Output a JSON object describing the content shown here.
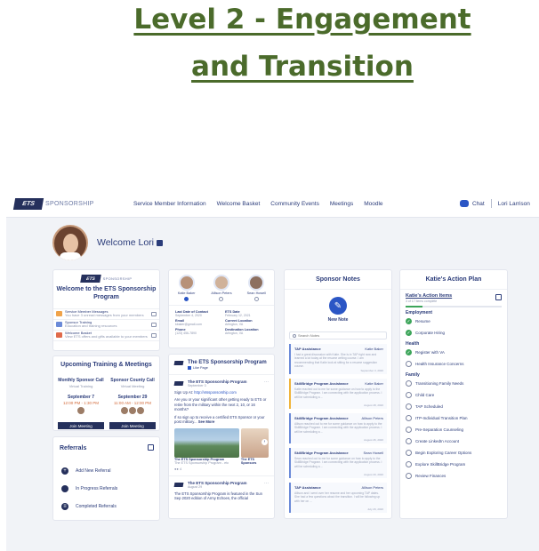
{
  "slide": {
    "title_line1": "Level 2 - Engagement",
    "title_line2": "and Transition"
  },
  "nav": {
    "logo": "ETS",
    "logo_word": "SPONSORSHIP",
    "links": [
      "Service Member Information",
      "Welcome Basket",
      "Community Events",
      "Meetings",
      "Moodle"
    ],
    "chat": "Chat",
    "user": "Lori Larrison"
  },
  "welcome": {
    "text": "Welcome Lori"
  },
  "program_card": {
    "title_line1": "Welcome to the ETS Sponsorship",
    "title_line2": "Program",
    "rows": [
      {
        "title": "Service Member Messages",
        "sub": "You have 3 unread messages from your members"
      },
      {
        "title": "Sponsor Training",
        "sub": "Education and training resources"
      },
      {
        "title": "Welcome Basket",
        "sub": "View ETS offers and gifts available to your members"
      }
    ]
  },
  "training": {
    "title": "Upcoming Training & Meetings",
    "meetings": [
      {
        "title": "Monthly Sponsor Call",
        "sub": "Virtual Training",
        "date": "September 7",
        "time": "12:00 PM - 1:30 PM",
        "join": "Join Meeting"
      },
      {
        "title": "Sponsor County Call",
        "sub": "Virtual Meeting",
        "date": "September 29",
        "time": "11:00 AM - 12:00 PM",
        "join": "Join Meeting"
      }
    ]
  },
  "referrals": {
    "title": "Referrals",
    "items": [
      "Add New Referral",
      "In Progress Referrals",
      "Completed Referrals"
    ]
  },
  "member_card": {
    "people": [
      {
        "name": "Katie Baker",
        "selected": true
      },
      {
        "name": "Allison Peters",
        "selected": false
      },
      {
        "name": "Sean Howell",
        "selected": false
      }
    ],
    "fields": [
      {
        "k": "Last Date of Contact",
        "v": "September 4, 2020"
      },
      {
        "k": "ETS Date",
        "v": "February 12, 2021"
      },
      {
        "k": "Email",
        "v": "kbaker@gmail.com"
      },
      {
        "k": "Current Location",
        "v": "Arlington, VA"
      },
      {
        "k": "Phone",
        "v": "(123) 456-7890"
      },
      {
        "k": "Destination Location",
        "v": "Arlington, VA"
      }
    ]
  },
  "feed": {
    "title": "The ETS Sponsorship Program",
    "sub": "Like Page",
    "post1": {
      "author": "The ETS Sponsorship Program",
      "date": "September 3",
      "signup": "Sign Up At:",
      "link": "http://etssponsorship.com",
      "body": "Are you or your significant other getting ready to ETS or retire from the military within the next 2, 10, or 16 months?",
      "body2": "If so sign up to receive a certified ETS Sponsor or your post military...",
      "see_more": "See More",
      "caption1_title": "The ETS Sponsorship Program",
      "caption1_sub": "The ETS Sponsorship Program - etc",
      "caption2_title": "The ETS Sponsors",
      "reactions": "4"
    },
    "post2": {
      "author": "The ETS Sponsorship Program",
      "date": "August 29",
      "body": "The ETS Sponsorship Program is featured in the Sun Sep 2020 edition of Army Echoes, the official"
    }
  },
  "sponsor_notes": {
    "title": "Sponsor Notes",
    "new_note": "New Note",
    "search_placeholder": "Search Notes",
    "notes": [
      {
        "title": "TAP Assistance",
        "who": "Katie Baker",
        "body": "I had a great discussion with Katie. She is in TAP right now and learned a lot today at the resume writing course. I am recommending that Katie look at sitting for a resume suggestion course.",
        "date": "September 3, 2020",
        "color": "blue"
      },
      {
        "title": "SkillBridge Program Assistance",
        "who": "Katie Baker",
        "body": "Katie reached out to me for some guidance on how to apply to the SkillBridge Program. I am connecting with the application process. I will be scheduling a ...",
        "date": "August 28, 2020",
        "color": "yellow"
      },
      {
        "title": "SkillBridge Program Assistance",
        "who": "Allison Peters",
        "body": "Allison reached out to me for some guidance on how to apply to the SkillBridge Program. I am connecting with the application process. I will be scheduling a ...",
        "date": "August 26, 2020",
        "color": "blue"
      },
      {
        "title": "SkillBridge Program Assistance",
        "who": "Sean Howell",
        "body": "Sean reached out to me for some guidance on how to apply to the SkillBridge Program. I am connecting with the application process. I will be scheduling a ...",
        "date": "August 20, 2020",
        "color": "blue"
      },
      {
        "title": "TAP Assistance",
        "who": "Allison Peters",
        "body": "Allison and I went over her resume and her upcoming TAP dates. She had a few questions about the transition. I will be following up with her on ...",
        "date": "July 29, 2020",
        "color": "blue"
      }
    ]
  },
  "action_plan": {
    "title": "Katie's Action Plan",
    "items_title": "Katie's Action Items",
    "items_sub": "3 of 17 items complete",
    "progress": 0.18,
    "categories": [
      {
        "name": "Employment",
        "tasks": [
          {
            "label": "Resume",
            "done": true
          },
          {
            "label": "Corporate Hiring",
            "done": true
          }
        ]
      },
      {
        "name": "Health",
        "tasks": [
          {
            "label": "Register with VA",
            "done": true
          },
          {
            "label": "Health Insurance Concerns",
            "done": false
          }
        ]
      },
      {
        "name": "Family",
        "tasks": [
          {
            "label": "Transitioning Family Needs",
            "done": false
          },
          {
            "label": "Child Care",
            "done": false
          },
          {
            "label": "TAP Scheduled",
            "done": false
          },
          {
            "label": "ITP-Individual Transition Plan",
            "done": false
          },
          {
            "label": "Pre-Separation Counseling",
            "done": false
          },
          {
            "label": "Create LinkedIn Account",
            "done": false
          },
          {
            "label": "Begin Exploring Career Options",
            "done": false
          },
          {
            "label": "Explore SkillBridge Program",
            "done": false
          },
          {
            "label": "Review Finances",
            "done": false
          }
        ]
      }
    ]
  },
  "colors": {
    "title_green": "#4b6b2b",
    "navy": "#25305c",
    "accent_blue": "#2b56c5",
    "check_green": "#3da55a",
    "note_yellow": "#f0b43a"
  }
}
